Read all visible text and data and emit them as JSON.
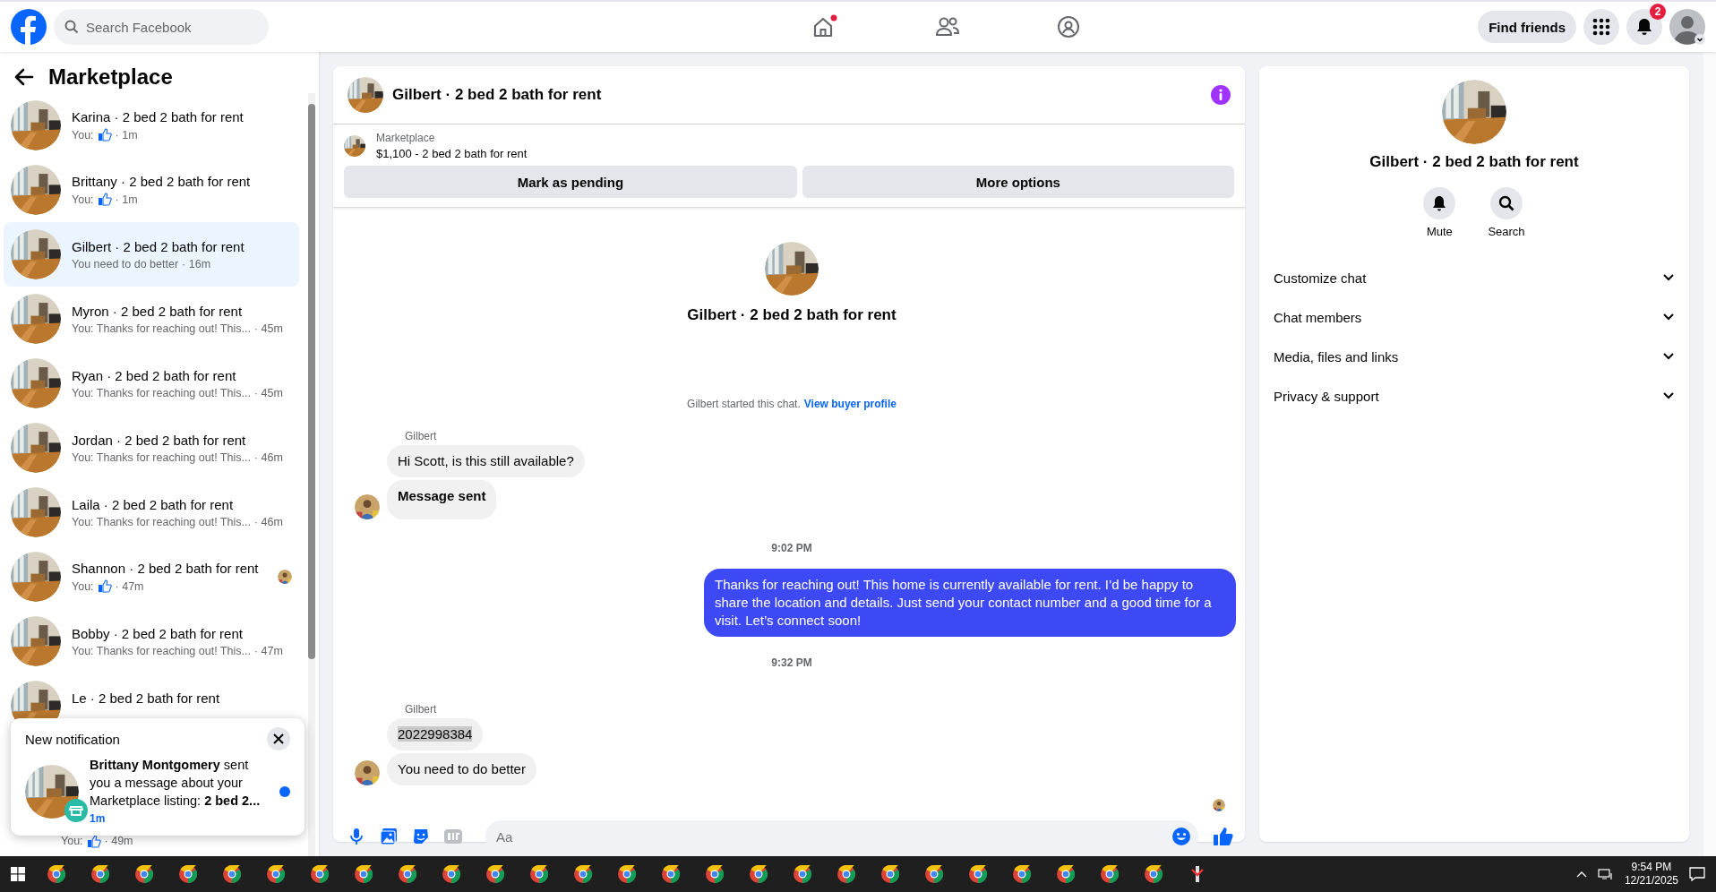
{
  "topbar": {
    "search": {
      "placeholder": "Search Facebook"
    },
    "find_friends": "Find friends",
    "notification_count": "2"
  },
  "sidebar": {
    "title": "Marketplace",
    "conversations": [
      {
        "name": "Karina · 2 bed 2 bath for rent",
        "preview": "You:",
        "like": true,
        "time": "· 1m",
        "selected": false,
        "seen": false
      },
      {
        "name": "Brittany · 2 bed 2 bath for rent",
        "preview": "You:",
        "like": true,
        "time": "· 1m",
        "selected": false,
        "seen": false
      },
      {
        "name": "Gilbert · 2 bed 2 bath for rent",
        "preview": "You need to do better",
        "like": false,
        "time": "· 16m",
        "selected": true,
        "seen": false
      },
      {
        "name": "Myron · 2 bed 2 bath for rent",
        "preview": "You: Thanks for reaching out! This...",
        "like": false,
        "time": "· 45m",
        "selected": false,
        "seen": false
      },
      {
        "name": "Ryan · 2 bed 2 bath for rent",
        "preview": "You: Thanks for reaching out! This...",
        "like": false,
        "time": "· 45m",
        "selected": false,
        "seen": false
      },
      {
        "name": "Jordan · 2 bed 2 bath for rent",
        "preview": "You: Thanks for reaching out! This...",
        "like": false,
        "time": "· 46m",
        "selected": false,
        "seen": false
      },
      {
        "name": "Laila · 2 bed 2 bath for rent",
        "preview": "You: Thanks for reaching out! This...",
        "like": false,
        "time": "· 46m",
        "selected": false,
        "seen": false
      },
      {
        "name": "Shannon · 2 bed 2 bath for rent",
        "preview": "You:",
        "like": true,
        "time": "· 47m",
        "selected": false,
        "seen": true
      },
      {
        "name": "Bobby · 2 bed 2 bath for rent",
        "preview": "You: Thanks for reaching out! This...",
        "like": false,
        "time": "· 47m",
        "selected": false,
        "seen": false
      },
      {
        "name": "Le · 2 bed 2 bath for rent",
        "selected": false
      },
      {
        "preview": "You:",
        "like": true,
        "time": "· 49m",
        "selected": false,
        "seen": false
      }
    ],
    "notification": {
      "heading": "New notification",
      "text": "**Brittany Montgomery** sent you a message about your Marketplace listing: **2 bed 2...**",
      "time": "1m",
      "unread": true
    }
  },
  "chat": {
    "title": "Gilbert · 2 bed 2 bath for rent",
    "listing": {
      "label": "Marketplace",
      "title": "$1,100 - 2 bed 2 bath for rent"
    },
    "buttons": [
      "Mark as pending",
      "More options"
    ],
    "intro_title": "Gilbert · 2 bed 2 bath for rent",
    "system": {
      "text": "Gilbert started this chat.",
      "link": "View buyer profile"
    },
    "messages": [
      {
        "kind": "sender",
        "text": "Gilbert"
      },
      {
        "kind": "incoming",
        "text": "Hi Scott, is this still available?",
        "avatar": false,
        "bold": false,
        "highlighted": false
      },
      {
        "kind": "incoming",
        "text": "Message sent",
        "avatar": true,
        "bold": true,
        "highlighted": false
      },
      {
        "kind": "time",
        "text": "9:02 PM"
      },
      {
        "kind": "outgoing",
        "text": "Thanks for reaching out! This home is currently available for rent. I’d be happy to share the location and details. Just send your contact number and a good time for a visit. Let’s connect soon!"
      },
      {
        "kind": "time",
        "text": "9:32 PM"
      },
      {
        "kind": "sender",
        "text": "Gilbert"
      },
      {
        "kind": "incoming",
        "text": "2022998384",
        "avatar": false,
        "bold": false,
        "highlighted": true
      },
      {
        "kind": "incoming",
        "text": "You need to do better",
        "avatar": true,
        "bold": false,
        "highlighted": false
      }
    ],
    "composer": {
      "placeholder": "Aa"
    }
  },
  "details": {
    "title": "Gilbert · 2 bed 2 bath for rent",
    "actions": [
      "Mute",
      "Search"
    ],
    "sections": [
      {
        "label": "Customize chat",
        "expanded": false
      },
      {
        "label": "Chat members",
        "expanded": false
      },
      {
        "label": "Media, files and links",
        "expanded": false
      },
      {
        "label": "Privacy & support",
        "expanded": false
      }
    ]
  },
  "taskbar": {
    "time": "9:54 PM",
    "date": "12/21/2025"
  }
}
